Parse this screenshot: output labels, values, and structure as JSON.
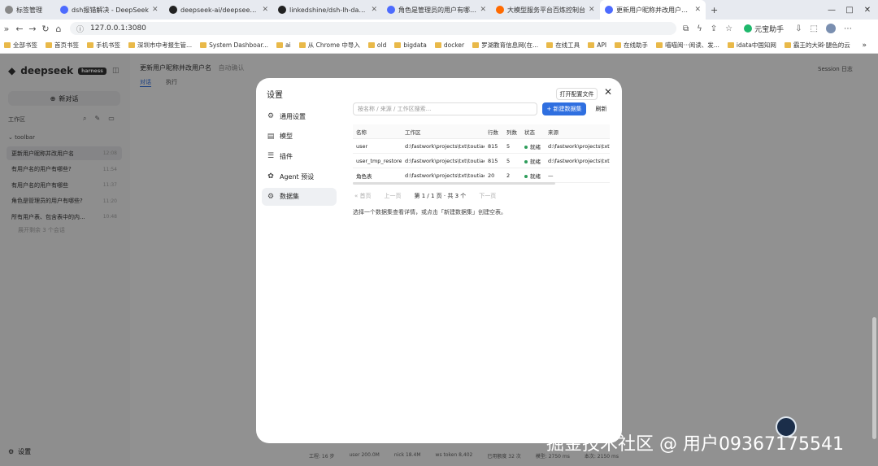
{
  "browser": {
    "tabs": [
      {
        "title": "标签管理",
        "color": "#888888"
      },
      {
        "title": "dsh报错解决 - DeepSeek",
        "color": "#4d6bfe"
      },
      {
        "title": "deepseek-ai/deepseek-harness",
        "color": "#222222"
      },
      {
        "title": "linkedshine/dsh-lh-data: agentic",
        "color": "#222222"
      },
      {
        "title": "角色是管理员的用户有哪些? — De",
        "color": "#4d6bfe"
      },
      {
        "title": "大模型服务平台百炼控制台",
        "color": "#ff6a00"
      },
      {
        "title": "更新用户昵称并改用户名 — De",
        "color": "#4d6bfe",
        "active": true
      }
    ],
    "new_tab": "+",
    "window_controls": [
      "—",
      "□",
      "✕"
    ],
    "url": "127.0.0.1:3080",
    "assistant_label": "元宝助手",
    "bookmarks": [
      "全部书签",
      "首页书签",
      "手机书签",
      "深圳市中考报生管...",
      "System Dashboar...",
      "ai",
      "从 Chrome 中导入",
      "old",
      "bigdata",
      "docker",
      "罗湖教育信息网(在...",
      "在线工具",
      "API",
      "在线助手",
      "喵喵阅···阅读、发...",
      "idata中国知网",
      "霸王的大辫·腿色的云"
    ],
    "bookmark_more": "»"
  },
  "app": {
    "logo_text": "deepseek",
    "logo_badge": "harness",
    "new_chat": "新对话",
    "workspace_label": "工作区",
    "group_label": "toolbar",
    "conversations": [
      {
        "title": "更新用户昵称并改用户名",
        "time": "12:08",
        "selected": true
      },
      {
        "title": "有用户名的用户有哪些?",
        "time": "11:54"
      },
      {
        "title": "有用户名的用户有哪些",
        "time": "11:37"
      },
      {
        "title": "角色是管理员的用户有哪些?",
        "time": "11:20"
      },
      {
        "title": "所有用户表、包含表中的内...",
        "time": "10:48"
      }
    ],
    "more_label": "展开剩余 3 个会话",
    "settings_label": "设置",
    "main_title": "更新用户昵称并改用户名",
    "main_title_extra": "自动确认",
    "main_tabs": [
      "对话",
      "执行"
    ],
    "session_label": "Session 日志",
    "bg_lines": [
      "...",
      "...",
      "...",
      "..."
    ],
    "footer_items": [
      "工程: 16 步",
      "user 200.0M",
      "nick 18.4M",
      "ws token 8,402",
      "已用额度 32 次",
      "模型: 2750 ms",
      "本次: 2150 ms"
    ]
  },
  "settings": {
    "title": "设置",
    "close_label": "✕",
    "open_config": "打开配置文件",
    "nav": [
      {
        "label": "通用设置",
        "icon": "gear-icon"
      },
      {
        "label": "模型",
        "icon": "database-icon"
      },
      {
        "label": "插件",
        "icon": "sliders-icon"
      },
      {
        "label": "Agent 预设",
        "icon": "agent-icon"
      },
      {
        "label": "数据集",
        "icon": "dataset-icon",
        "selected": true
      }
    ],
    "search_placeholder": "按名称 / 来源 / 工作区搜索...",
    "new_dataset": "+ 新建数据集",
    "refresh": "刷新",
    "table": {
      "headers": [
        "名称",
        "工作区",
        "行数",
        "列数",
        "状态",
        "来源"
      ],
      "rows": [
        [
          "user",
          "d:\\fastwork\\projects\\txt\\toutiao",
          "815",
          "5",
          "就绪",
          "d:\\fastwork\\projects\\txt\\toutiao"
        ],
        [
          "user_tmp_restore",
          "d:\\fastwork\\projects\\txt\\toutiao",
          "815",
          "5",
          "就绪",
          "d:\\fastwork\\projects\\txt\\toutiao"
        ],
        [
          "角色表",
          "d:\\fastwork\\projects\\txt\\toutiao",
          "20",
          "2",
          "就绪",
          "—"
        ]
      ]
    },
    "pager": {
      "first": "« 首页",
      "prev": "上一页",
      "current": "第 1 / 1 页 · 共 3 个",
      "next": "下一页"
    },
    "hint": "选择一个数据集查看详情，或点击「新建数据集」创建空表。"
  },
  "watermark": "掘金技术社区 @ 用户09367175541"
}
